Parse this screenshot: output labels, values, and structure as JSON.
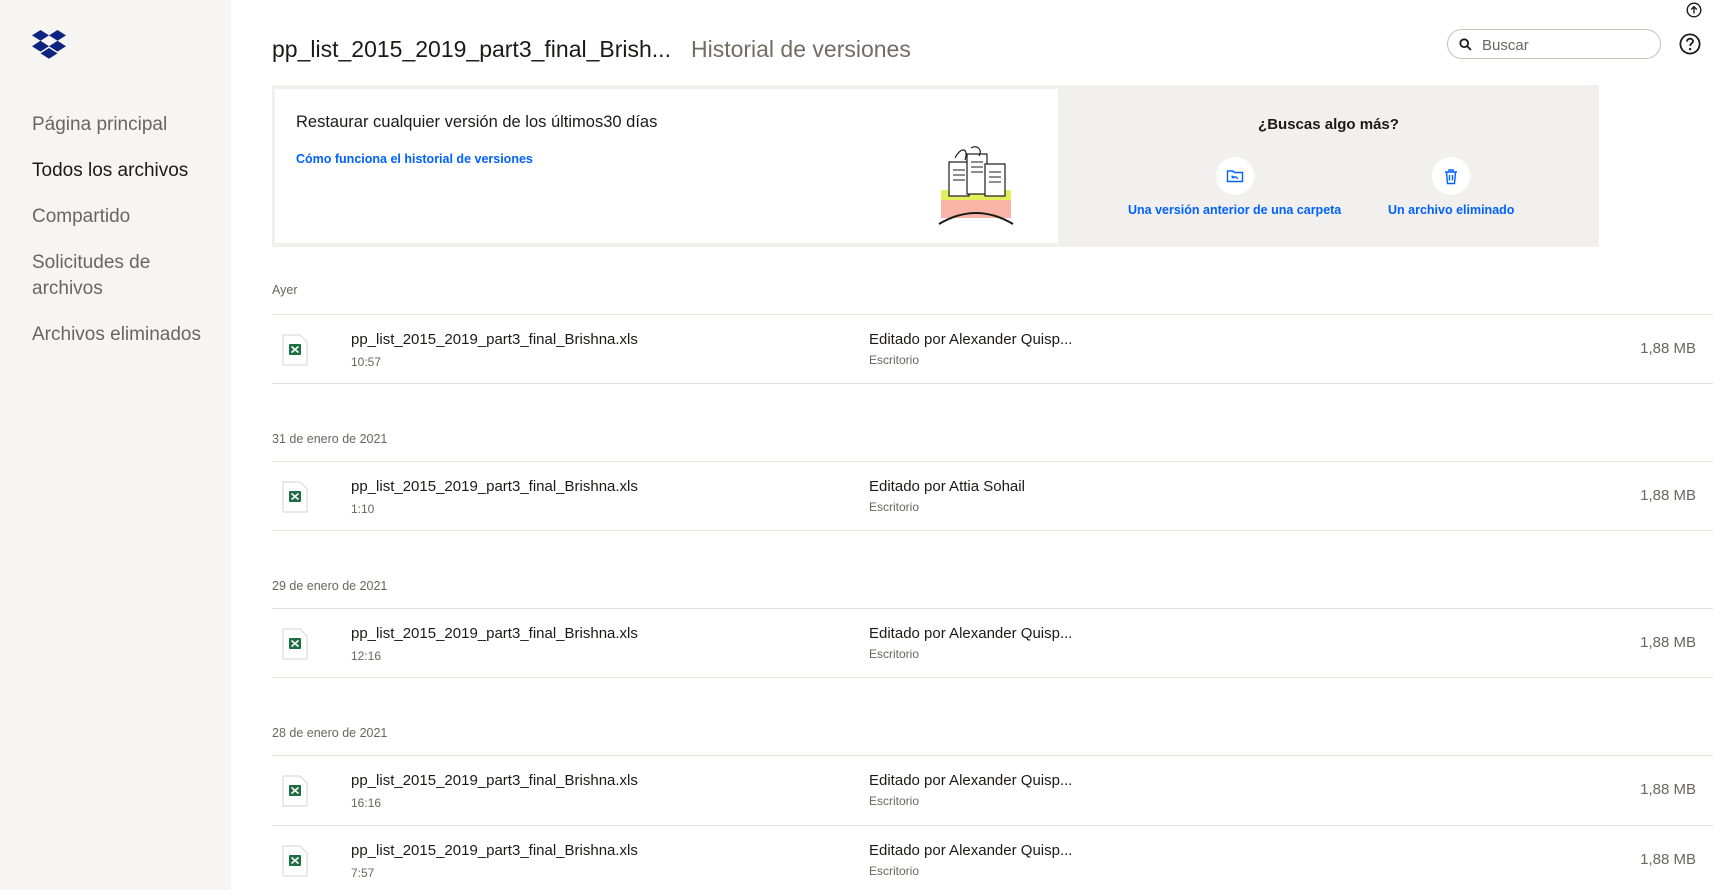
{
  "sidebar": {
    "logo": "dropbox-logo",
    "items": [
      {
        "label": "Página principal",
        "active": false
      },
      {
        "label": "Todos los archivos",
        "active": true
      },
      {
        "label": "Compartido",
        "active": false
      },
      {
        "label": "Solicitudes de archivos",
        "active": false
      },
      {
        "label": "Archivos eliminados",
        "active": false
      }
    ]
  },
  "header": {
    "file_title": "pp_list_2015_2019_part3_final_Brish...",
    "subtitle": "Historial de versiones",
    "search_placeholder": "Buscar",
    "upload_icon": "upload-icon",
    "help_icon": "help-icon"
  },
  "banner": {
    "heading": "Restaurar cualquier versión de los últimos30 días",
    "link": "Cómo funciona el historial de versiones",
    "right_heading": "¿Buscas algo más?",
    "options": [
      {
        "label": "Una versión anterior de una carpeta",
        "icon": "folder-restore-icon"
      },
      {
        "label": "Un archivo eliminado",
        "icon": "trash-icon"
      }
    ]
  },
  "versions": [
    {
      "date": "Ayer",
      "items": [
        {
          "name": "pp_list_2015_2019_part3_final_Brishna.xls",
          "time": "10:57",
          "editor": "Editado por Alexander Quisp...",
          "device": "Escritorio",
          "size": "1,88 MB"
        }
      ]
    },
    {
      "date": "31 de enero de 2021",
      "items": [
        {
          "name": "pp_list_2015_2019_part3_final_Brishna.xls",
          "time": "1:10",
          "editor": "Editado por Attia Sohail",
          "device": "Escritorio",
          "size": "1,88 MB"
        }
      ]
    },
    {
      "date": "29 de enero de 2021",
      "items": [
        {
          "name": "pp_list_2015_2019_part3_final_Brishna.xls",
          "time": "12:16",
          "editor": "Editado por Alexander Quisp...",
          "device": "Escritorio",
          "size": "1,88 MB"
        }
      ]
    },
    {
      "date": "28 de enero de 2021",
      "items": [
        {
          "name": "pp_list_2015_2019_part3_final_Brishna.xls",
          "time": "16:16",
          "editor": "Editado por Alexander Quisp...",
          "device": "Escritorio",
          "size": "1,88 MB"
        },
        {
          "name": "pp_list_2015_2019_part3_final_Brishna.xls",
          "time": "7:57",
          "editor": "Editado por Alexander Quisp...",
          "device": "Escritorio",
          "size": "1,88 MB"
        }
      ]
    }
  ],
  "colors": {
    "sidebar_bg": "#f7f5f2",
    "link_blue": "#0061fe",
    "excel_green": "#1d6f42",
    "dropbox_blue": "#0d2481"
  }
}
